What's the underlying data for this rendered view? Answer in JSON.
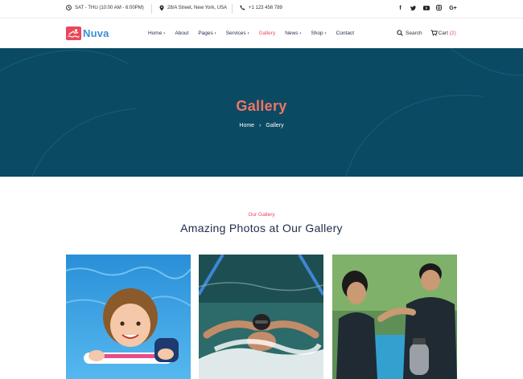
{
  "topbar": {
    "hours": "SAT - THU (10:00 AM - 6:00PM)",
    "address": "28/A Street, New York, USA",
    "phone": "+1 123 456 789",
    "social": [
      {
        "name": "facebook-icon",
        "glyph": "f"
      },
      {
        "name": "twitter-icon",
        "glyph": "t"
      },
      {
        "name": "youtube-icon",
        "glyph": "▶"
      },
      {
        "name": "instagram-icon",
        "glyph": "◎"
      },
      {
        "name": "google-plus-icon",
        "glyph": "G+"
      }
    ]
  },
  "brand": {
    "name": "Nuva",
    "accent": "#e9485a",
    "blue": "#3a8fd6"
  },
  "nav": {
    "items": [
      {
        "label": "Home ›"
      },
      {
        "label": "About"
      },
      {
        "label": "Pages ›"
      },
      {
        "label": "Services ›"
      },
      {
        "label": "Gallery"
      },
      {
        "label": "News ›"
      },
      {
        "label": "Shop ›"
      },
      {
        "label": "Contact"
      }
    ],
    "search_label": "Search",
    "cart_label": "Cart",
    "cart_count": "(2)"
  },
  "hero": {
    "title": "Gallery",
    "breadcrumb_home": "Home",
    "breadcrumb_sep": "›",
    "breadcrumb_current": "Gallery",
    "bg_color": "#0b4a63"
  },
  "section": {
    "subtitle": "Our Gallery",
    "title": "Amazing Photos at Our Gallery"
  }
}
